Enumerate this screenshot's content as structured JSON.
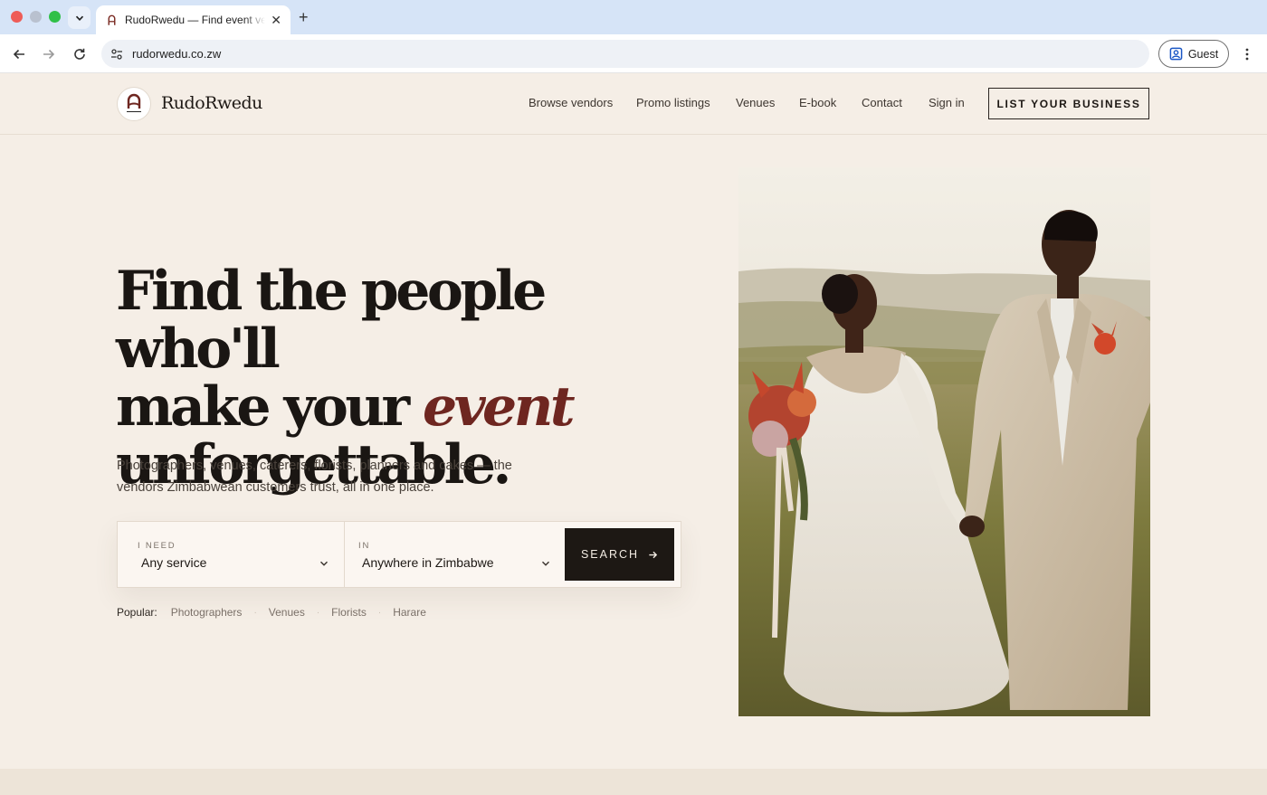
{
  "browser": {
    "tab_title": "RudoRwedu — Find event vendors",
    "url": "rudorwedu.co.zw",
    "profile_label": "Guest"
  },
  "site": {
    "brand": "RudoRwedu",
    "nav": [
      "Browse vendors",
      "Promo listings",
      "Venues",
      "E-book",
      "Contact",
      "Sign in"
    ],
    "cta": "LIST YOUR BUSINESS"
  },
  "hero": {
    "headline_line1": "Find the people who'll",
    "headline_line2_start": "make your ",
    "headline_emphasis": "event",
    "headline_line3": "unforgettable.",
    "subtitle": "Photographers, venues, caterers, florists, planners and cakes — the vendors Zimbabwean customers trust, all in one place."
  },
  "search": {
    "need_label": "I NEED",
    "need_value": "Any service",
    "in_label": "IN",
    "in_value": "Anywhere in Zimbabwe",
    "button_label": "SEARCH"
  },
  "popular": {
    "label": "Popular:",
    "items": [
      "Photographers",
      "Venues",
      "Florists",
      "Harare"
    ]
  },
  "colors": {
    "page_bg": "#f5eee6",
    "accent": "#6e2620",
    "dark": "#1d1814"
  }
}
